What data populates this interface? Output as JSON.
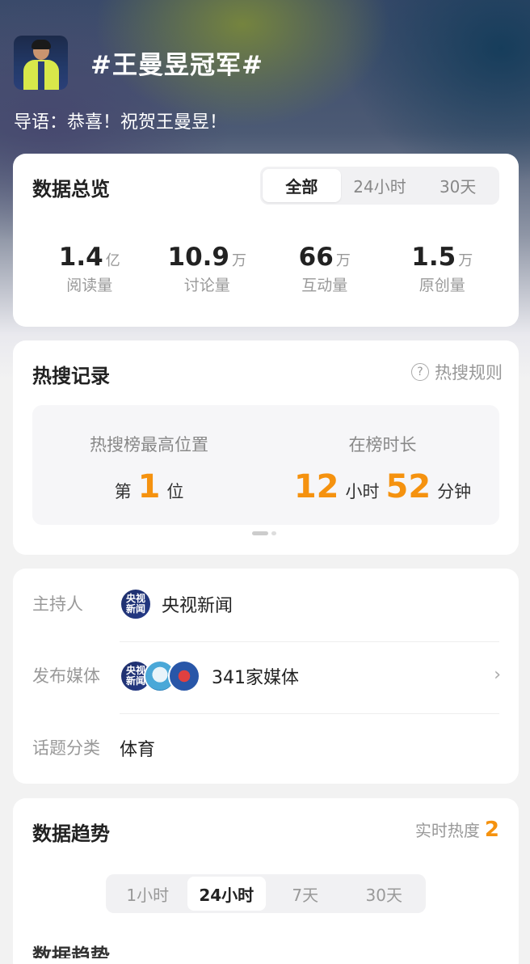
{
  "header": {
    "topic_title": "#王曼昱冠军#",
    "guide": "导语：恭喜！祝贺王曼昱！"
  },
  "overview": {
    "title": "数据总览",
    "tabs": [
      "全部",
      "24小时",
      "30天"
    ],
    "active_tab": "全部",
    "stats": [
      {
        "value": "1.4",
        "unit": "亿",
        "label": "阅读量"
      },
      {
        "value": "10.9",
        "unit": "万",
        "label": "讨论量"
      },
      {
        "value": "66",
        "unit": "万",
        "label": "互动量"
      },
      {
        "value": "1.5",
        "unit": "万",
        "label": "原创量"
      }
    ]
  },
  "hot_search": {
    "title": "热搜记录",
    "rules_label": "热搜规则",
    "highest_label": "热搜榜最高位置",
    "highest_prefix": "第",
    "highest_value": "1",
    "highest_suffix": "位",
    "duration_label": "在榜时长",
    "duration_hours": "12",
    "duration_hours_unit": "小时",
    "duration_minutes": "52",
    "duration_minutes_unit": "分钟"
  },
  "info": {
    "host_key": "主持人",
    "host_value": "央视新闻",
    "host_logo_text": "央视新闻",
    "media_key": "发布媒体",
    "media_value": "341家媒体",
    "category_key": "话题分类",
    "category_value": "体育"
  },
  "trend": {
    "title": "数据趋势",
    "realtime_label": "实时热度",
    "realtime_value": "2",
    "tabs": [
      "1小时",
      "24小时",
      "7天",
      "30天"
    ],
    "active_tab": "24小时",
    "next_section_peek": "数据趋势"
  },
  "colors": {
    "accent_orange": "#f5920f",
    "card_bg": "#ffffff",
    "page_bg": "#f2f2f2"
  }
}
